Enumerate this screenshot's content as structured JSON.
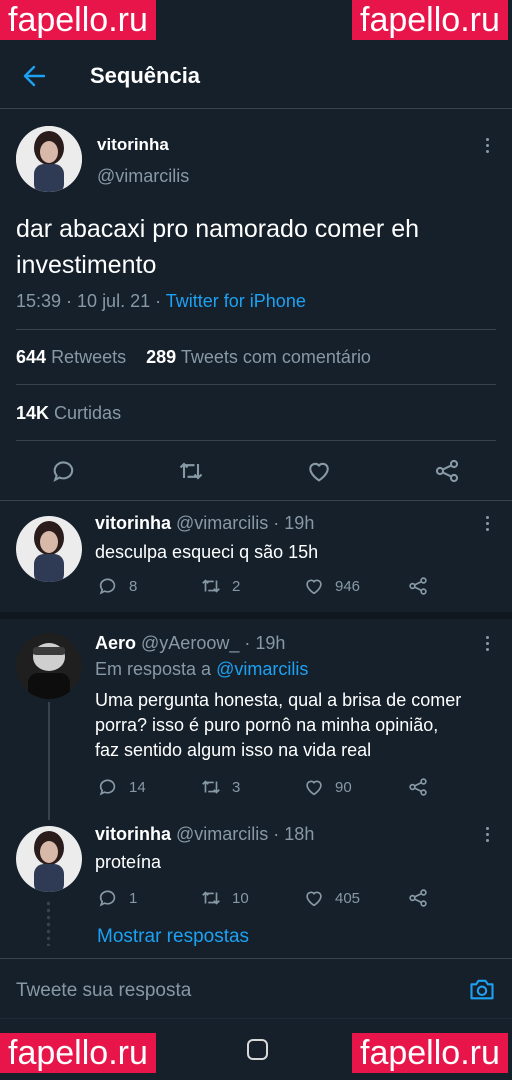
{
  "watermark": {
    "text": "fapello.ru"
  },
  "header": {
    "title": "Sequência"
  },
  "main_tweet": {
    "display_name": "vitorinha",
    "handle": "@vimarcilis",
    "text_line1": "dar abacaxi pro namorado comer eh",
    "text_line2": "investimento",
    "meta_time": "15:39 · 10 jul. 21 ·",
    "meta_source": "Twitter for iPhone",
    "retweets_count": "644",
    "retweets_label": "Retweets",
    "comments_count": "289",
    "comments_label": "Tweets com comentário",
    "likes_count": "14K",
    "likes_label": "Curtidas"
  },
  "replies": [
    {
      "display_name": "vitorinha",
      "meta": "@vimarcilis · 19h",
      "text": "desculpa esqueci q são 15h",
      "replies": "8",
      "retweets": "2",
      "likes": "946"
    },
    {
      "display_name": "Aero",
      "meta": "@yAeroow_ · 19h",
      "reply_to_label": "Em resposta a",
      "reply_to_handle": "@vimarcilis",
      "text_line1": "Uma pergunta honesta, qual a brisa de comer",
      "text_line2": "porra? isso é puro pornô na minha opinião,",
      "text_line3": "faz sentido algum isso na vida real",
      "replies": "14",
      "retweets": "3",
      "likes": "90"
    },
    {
      "display_name": "vitorinha",
      "meta": "@vimarcilis · 18h",
      "text": "proteína",
      "replies": "1",
      "retweets": "10",
      "likes": "405"
    }
  ],
  "show_replies": "Mostrar respostas",
  "composer": {
    "placeholder": "Tweete sua resposta"
  },
  "colors": {
    "background": "#15202b",
    "accent": "#1da1f2",
    "muted": "#8899a6",
    "divider": "#38444d",
    "watermark": "#e8154a"
  },
  "icons": [
    "back-arrow-icon",
    "more-vertical-icon",
    "reply-icon",
    "retweet-icon",
    "like-icon",
    "share-icon",
    "camera-icon",
    "home-button-icon"
  ]
}
